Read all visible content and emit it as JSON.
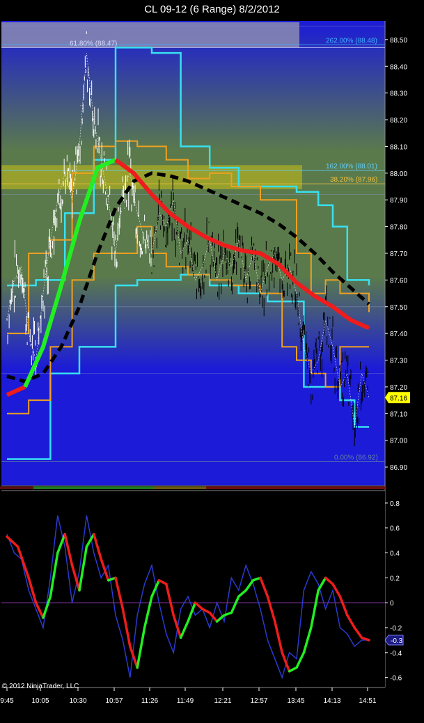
{
  "window": {
    "title": "CL 09-12 (6 Range)  8/2/2012"
  },
  "copyright": "© 2012 NinjaTrader, LLC",
  "colors": {
    "upper_bg_top": "#1b1bd8",
    "upper_bg_band": "#5a7a4c",
    "fib_zone": "#b0b020",
    "cyan_channel": "#38e0f0",
    "orange_channel": "#f0a020",
    "up_trend": "#22ee22",
    "down_trend": "#ee1c1c",
    "black_dash": "#000000",
    "price_tag": "#ffff00"
  },
  "chart_data": [
    {
      "type": "line",
      "panel": "price",
      "title": "",
      "x_ticks": [
        "9:45",
        "10:05",
        "10:30",
        "10:57",
        "11:26",
        "11:49",
        "12:21",
        "12:57",
        "13:45",
        "14:13",
        "14:51"
      ],
      "y_ticks": [
        "88.50",
        "88.40",
        "88.30",
        "88.20",
        "88.10",
        "88.00",
        "87.90",
        "87.80",
        "87.70",
        "87.60",
        "87.50",
        "87.40",
        "87.30",
        "87.20",
        "87.10",
        "87.00",
        "86.90"
      ],
      "ylim": [
        86.83,
        88.57
      ],
      "last_price_label": "87.16",
      "fib_levels": [
        {
          "label": "262.00% (88.48)",
          "value": 88.48
        },
        {
          "label": "61.80% (88.47)",
          "value": 88.47
        },
        {
          "label": "162.00% (88.01)",
          "value": 88.01
        },
        {
          "label": "38.20% (87.96)",
          "value": 87.96
        },
        {
          "label": "0.00% (86.92)",
          "value": 86.92
        }
      ],
      "series": [
        {
          "role": "price",
          "x": [
            0,
            2,
            4,
            6,
            8,
            10,
            12,
            14,
            16,
            18,
            20,
            22,
            24,
            26,
            28,
            30,
            32,
            34,
            36,
            38,
            40,
            42,
            44,
            46,
            48,
            50,
            52,
            54,
            56,
            58,
            60,
            62,
            64,
            66,
            68,
            70,
            72,
            74,
            76,
            78,
            80,
            82,
            84,
            86,
            88,
            90,
            92,
            94,
            96,
            98,
            100
          ],
          "y": [
            87.45,
            87.6,
            87.65,
            87.4,
            87.3,
            87.55,
            87.75,
            87.9,
            88.0,
            87.9,
            88.1,
            88.45,
            88.2,
            88.05,
            87.9,
            87.7,
            87.95,
            88.0,
            87.85,
            87.75,
            87.7,
            87.85,
            87.8,
            87.9,
            87.7,
            87.75,
            87.6,
            87.65,
            87.75,
            87.6,
            87.7,
            87.65,
            87.75,
            87.6,
            87.7,
            87.55,
            87.65,
            87.7,
            87.6,
            87.65,
            87.55,
            87.35,
            87.25,
            87.3,
            87.45,
            87.35,
            87.2,
            87.25,
            87.05,
            87.25,
            87.16
          ]
        },
        {
          "role": "trend-ma",
          "x": [
            0,
            5,
            10,
            15,
            20,
            25,
            30,
            35,
            40,
            45,
            50,
            55,
            60,
            65,
            70,
            75,
            80,
            85,
            90,
            95,
            100
          ],
          "y": [
            87.17,
            87.2,
            87.35,
            87.58,
            87.82,
            88.02,
            88.05,
            88.0,
            87.92,
            87.85,
            87.8,
            87.76,
            87.73,
            87.71,
            87.7,
            87.66,
            87.59,
            87.54,
            87.5,
            87.45,
            87.42
          ],
          "up_until_index": 6
        },
        {
          "role": "dashed-ma",
          "x": [
            0,
            5,
            10,
            15,
            20,
            25,
            30,
            35,
            40,
            45,
            50,
            55,
            60,
            65,
            70,
            75,
            80,
            85,
            90,
            95,
            100
          ],
          "y": [
            87.24,
            87.22,
            87.25,
            87.35,
            87.5,
            87.7,
            87.87,
            87.97,
            88.0,
            87.99,
            87.97,
            87.94,
            87.91,
            87.88,
            87.85,
            87.81,
            87.76,
            87.7,
            87.63,
            87.57,
            87.51
          ]
        },
        {
          "role": "cyan-upper",
          "x": [
            0,
            8,
            16,
            24,
            30,
            40,
            48,
            56,
            64,
            72,
            80,
            86,
            90,
            94,
            100
          ],
          "y": [
            87.58,
            87.6,
            87.85,
            88.05,
            88.47,
            88.45,
            88.1,
            88.02,
            87.95,
            87.95,
            87.93,
            87.88,
            87.8,
            87.6,
            87.58
          ]
        },
        {
          "role": "cyan-lower",
          "x": [
            0,
            8,
            12,
            20,
            30,
            36,
            40,
            48,
            56,
            64,
            72,
            78,
            82,
            86,
            92,
            96,
            100
          ],
          "y": [
            86.93,
            86.93,
            87.25,
            87.35,
            87.58,
            87.6,
            87.6,
            87.62,
            87.58,
            87.55,
            87.52,
            87.52,
            87.2,
            87.2,
            87.15,
            87.05,
            87.05
          ]
        },
        {
          "role": "orange-upper",
          "x": [
            0,
            6,
            12,
            18,
            24,
            30,
            36,
            40,
            44,
            50,
            56,
            62,
            70,
            76,
            80,
            84,
            88,
            92,
            100
          ],
          "y": [
            87.4,
            87.7,
            87.75,
            88.0,
            88.1,
            88.12,
            88.1,
            88.1,
            88.05,
            87.98,
            88.0,
            87.95,
            87.9,
            87.9,
            87.7,
            87.55,
            87.6,
            87.55,
            87.48
          ]
        },
        {
          "role": "orange-lower",
          "x": [
            0,
            6,
            12,
            18,
            24,
            30,
            36,
            40,
            44,
            50,
            56,
            62,
            70,
            76,
            80,
            84,
            88,
            92,
            100
          ],
          "y": [
            87.1,
            87.15,
            87.35,
            87.6,
            87.7,
            87.7,
            87.8,
            87.7,
            87.65,
            87.62,
            87.6,
            87.58,
            87.55,
            87.35,
            87.3,
            87.25,
            87.2,
            87.35,
            87.35
          ]
        }
      ]
    },
    {
      "type": "line",
      "panel": "oscillator",
      "title": "",
      "y_ticks": [
        "0.8",
        "0.6",
        "0.4",
        "0.2",
        "0",
        "-0.2",
        "-0.4",
        "-0.6"
      ],
      "ylim": [
        -0.68,
        0.9
      ],
      "last_value_label": "-0.3",
      "series": [
        {
          "role": "signal",
          "x": [
            0,
            3,
            6,
            8,
            10,
            12,
            14,
            16,
            18,
            20,
            22,
            24,
            26,
            28,
            30,
            32,
            34,
            36,
            38,
            40,
            42,
            44,
            46,
            48,
            50,
            52,
            54,
            56,
            58,
            60,
            62,
            64,
            66,
            68,
            70,
            72,
            74,
            76,
            78,
            80,
            82,
            84,
            86,
            88,
            90,
            92,
            94,
            96,
            98,
            100
          ],
          "y": [
            0.53,
            0.45,
            0.2,
            0.0,
            -0.12,
            0.05,
            0.4,
            0.55,
            0.3,
            0.1,
            0.45,
            0.55,
            0.35,
            0.18,
            0.2,
            -0.05,
            -0.35,
            -0.52,
            -0.2,
            0.05,
            0.18,
            0.15,
            -0.1,
            -0.28,
            -0.15,
            0.0,
            -0.05,
            -0.08,
            -0.15,
            -0.1,
            -0.08,
            0.05,
            0.1,
            0.18,
            0.2,
            0.05,
            -0.15,
            -0.4,
            -0.55,
            -0.52,
            -0.4,
            -0.2,
            0.1,
            0.2,
            0.15,
            0.05,
            -0.1,
            -0.2,
            -0.28,
            -0.3
          ]
        },
        {
          "role": "raw",
          "x": [
            0,
            2,
            4,
            6,
            8,
            10,
            12,
            14,
            16,
            18,
            20,
            22,
            24,
            26,
            28,
            30,
            32,
            34,
            36,
            38,
            40,
            42,
            44,
            46,
            48,
            50,
            52,
            54,
            56,
            58,
            60,
            62,
            64,
            66,
            68,
            70,
            72,
            74,
            76,
            78,
            80,
            82,
            84,
            86,
            88,
            90,
            92,
            94,
            96,
            98,
            100
          ],
          "y": [
            0.55,
            0.4,
            0.35,
            0.1,
            -0.05,
            -0.2,
            0.2,
            0.7,
            0.45,
            0.0,
            0.25,
            0.7,
            0.4,
            0.2,
            0.3,
            -0.1,
            -0.3,
            -0.6,
            -0.1,
            0.15,
            0.3,
            0.0,
            -0.25,
            -0.4,
            -0.05,
            0.05,
            -0.1,
            -0.05,
            -0.2,
            0.0,
            -0.15,
            0.2,
            0.1,
            0.3,
            0.15,
            -0.05,
            -0.3,
            -0.45,
            -0.6,
            -0.4,
            -0.45,
            0.1,
            0.25,
            0.15,
            -0.05,
            0.1,
            -0.2,
            -0.25,
            -0.35,
            -0.3,
            -0.3
          ]
        }
      ]
    }
  ]
}
